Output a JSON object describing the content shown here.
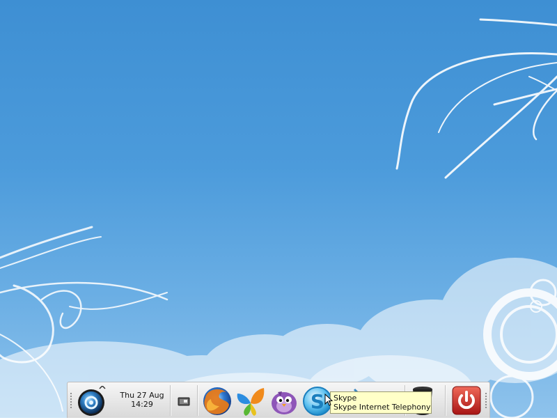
{
  "panel": {
    "clock": {
      "date": "Thu 27 Aug",
      "time": "14:29"
    },
    "launchers": [
      {
        "name": "firefox-icon"
      },
      {
        "name": "msn-messenger-icon"
      },
      {
        "name": "pidgin-icon"
      },
      {
        "name": "skype-icon"
      },
      {
        "name": "email-client-icon"
      }
    ],
    "power_icon": "power-icon"
  },
  "tooltip": {
    "title": "Skype",
    "description": "Skype Internet Telephony"
  },
  "colors": {
    "sky_top": "#3e8fd3",
    "sky_bottom": "#8fc3ec",
    "tooltip_bg": "#ffffc8",
    "power_red": "#d42a2a"
  }
}
